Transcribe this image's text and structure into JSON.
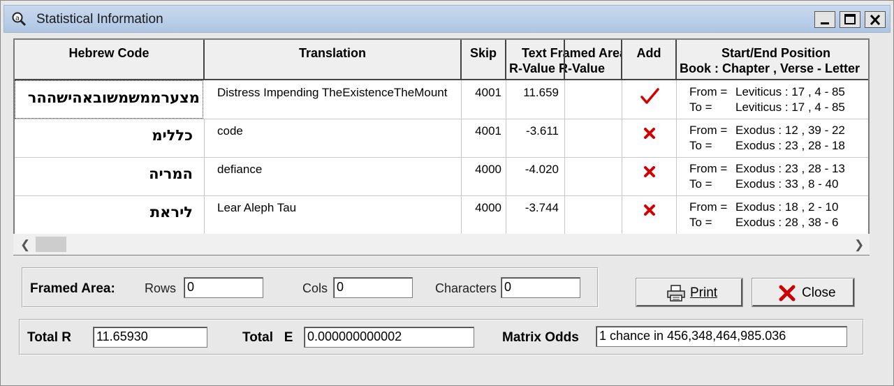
{
  "window": {
    "title": "Statistical Information",
    "app_icon": "magnifier-icon"
  },
  "grid": {
    "headers": {
      "hebrew": "Hebrew Code",
      "translation": "Translation",
      "skip": "Skip",
      "text_r_line1": "Text Framed Area",
      "text_r_line2": "R-Value R-Value",
      "add": "Add",
      "position_line1": "Start/End Position",
      "position_line2": "Book : Chapter , Verse - Letter"
    },
    "rows": [
      {
        "hebrew": "מצערממשמשובאהישההר",
        "translation": "Distress Impending TheExistenceTheMount",
        "skip": "4001",
        "text_r": "11.659",
        "framed_r": "",
        "add": "check",
        "from_label": "From =",
        "from": "Leviticus : 17 , 4 - 85",
        "to_label": "To =",
        "to": "Leviticus : 17 , 4 - 85"
      },
      {
        "hebrew": "כללימ",
        "translation": "code",
        "skip": "4001",
        "text_r": "-3.611",
        "framed_r": "",
        "add": "x",
        "from_label": "From =",
        "from": "Exodus : 12 , 39 - 22",
        "to_label": "To =",
        "to": "Exodus : 23 , 28 - 18"
      },
      {
        "hebrew": "המריה",
        "translation": "defiance",
        "skip": "4000",
        "text_r": "-4.020",
        "framed_r": "",
        "add": "x",
        "from_label": "From =",
        "from": "Exodus : 23 , 28 - 13",
        "to_label": "To =",
        "to": "Exodus : 33 , 8 - 40"
      },
      {
        "hebrew": "ליראת",
        "translation": "Lear Aleph Tau",
        "skip": "4000",
        "text_r": "-3.744",
        "framed_r": "",
        "add": "x",
        "from_label": "From =",
        "from": "Exodus : 18 , 2 - 10",
        "to_label": "To =",
        "to": "Exodus : 28 , 38 - 6"
      }
    ]
  },
  "framed_area": {
    "label": "Framed Area:",
    "rows_label": "Rows",
    "rows_value": "0",
    "cols_label": "Cols",
    "cols_value": "0",
    "chars_label": "Characters",
    "chars_value": "0"
  },
  "buttons": {
    "print": "Print",
    "close": "Close"
  },
  "totals": {
    "total_r_label": "Total R",
    "total_r_value": "11.65930",
    "total_e_label": "Total   E",
    "total_e_value": "0.000000000002",
    "matrix_odds_label": "Matrix Odds",
    "matrix_odds_value": "1 chance in 456,348,464,985.036"
  },
  "colors": {
    "accent_red": "#d40000",
    "title_bar": "#b7cde8"
  }
}
